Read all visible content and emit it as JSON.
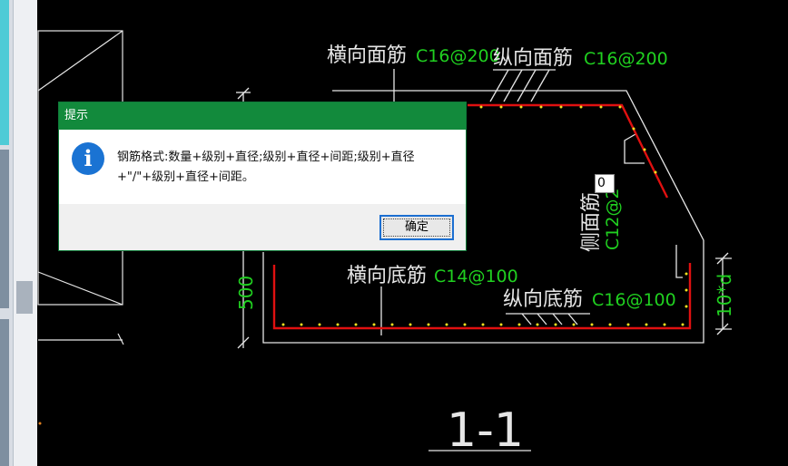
{
  "dialog": {
    "title": "提示",
    "icon": "info-icon",
    "message_line1": "钢筋格式:数量+级别+直径;级别+直径+间距;级别+直径",
    "message_line2": "+\"/\"+级别+直径+间距。",
    "ok_label": "确定"
  },
  "drawing": {
    "transverse_top_label": "横向面筋",
    "transverse_top_value": "C16@200",
    "longitudinal_top_label": "纵向面筋",
    "longitudinal_top_value": "C16@200",
    "side_label": "侧面筋",
    "side_value": "C12@2",
    "transverse_bottom_label": "横向底筋",
    "transverse_bottom_value": "C14@100",
    "longitudinal_bottom_label": "纵向底筋",
    "longitudinal_bottom_value": "C16@100",
    "dim_height": "500",
    "dim_anchor": "10*d",
    "section_name": "1-1",
    "edit_value": "0"
  },
  "colors": {
    "background": "#000000",
    "label_white": "#e6e6e6",
    "value_green": "#20d020",
    "rebar_red": "#e01010",
    "dot_yellow": "#f0e020",
    "titlebar_green": "#128a3c"
  }
}
